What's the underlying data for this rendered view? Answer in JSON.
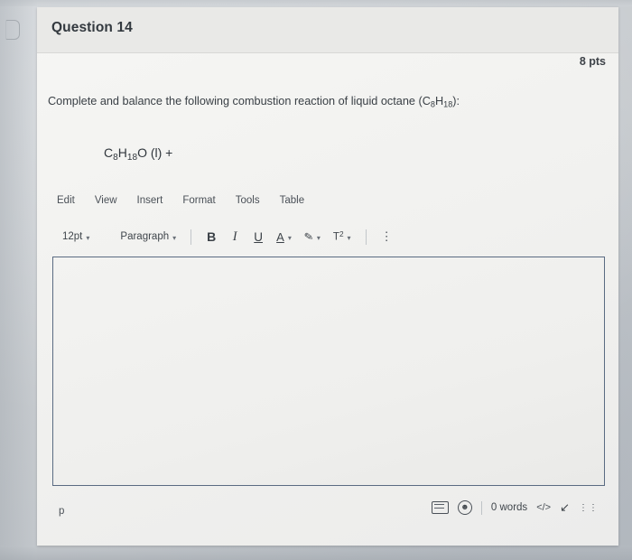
{
  "header": {
    "question_title": "Question 14",
    "points": "8 pts"
  },
  "prompt": {
    "text_before": "Complete and balance the following combustion reaction of liquid octane (C",
    "sub1": "8",
    "text_mid": "H",
    "sub2": "18",
    "text_after": "):"
  },
  "formula": {
    "c": "C",
    "sub_c": "8",
    "h": "H",
    "sub_h": "18",
    "o": "O",
    "state": " (l) +"
  },
  "editor": {
    "menus": [
      {
        "label": "Edit",
        "name": "menu-edit"
      },
      {
        "label": "View",
        "name": "menu-view"
      },
      {
        "label": "Insert",
        "name": "menu-insert"
      },
      {
        "label": "Format",
        "name": "menu-format"
      },
      {
        "label": "Tools",
        "name": "menu-tools"
      },
      {
        "label": "Table",
        "name": "menu-table"
      }
    ],
    "toolbar": {
      "font_size": "12pt",
      "block_format": "Paragraph",
      "bold": "B",
      "italic": "I",
      "underline": "U",
      "text_color": "A",
      "highlight": "✎",
      "superscript_label": "T",
      "superscript_sup": "2",
      "more_options": "⋮"
    },
    "body_text": "",
    "status": {
      "path": "p",
      "word_count": "0 words",
      "html_editor": "</>",
      "resize": "↙",
      "grip": "⁙",
      "keyboard_icon": "keyboard-shortcuts",
      "accessibility_icon": "accessibility-checker"
    }
  },
  "colors": {
    "card_bg": "#f2f2f0",
    "header_bg": "#e9e9e7",
    "editor_border": "#5a6b82",
    "text": "#3a4046"
  }
}
